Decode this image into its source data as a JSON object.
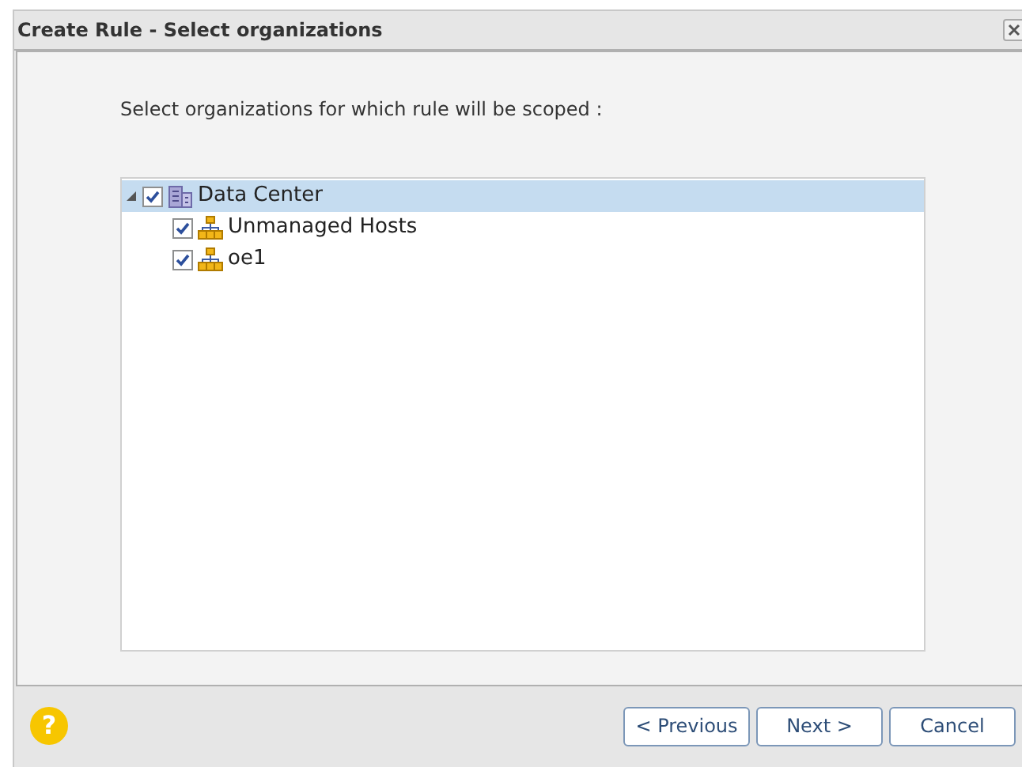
{
  "window": {
    "title": "Create Rule - Select organizations"
  },
  "instruction": "Select organizations for which rule will be scoped :",
  "tree": [
    {
      "label": "Data Center",
      "kind": "datacenter",
      "checked": true,
      "expanded": true,
      "selected": true,
      "children": [
        {
          "label": "Unmanaged Hosts",
          "kind": "organization",
          "checked": true,
          "selected": false
        },
        {
          "label": "oe1",
          "kind": "organization",
          "checked": true,
          "selected": false
        }
      ]
    }
  ],
  "help": "?",
  "buttons": [
    "< Previous",
    "Next >",
    "Cancel"
  ]
}
